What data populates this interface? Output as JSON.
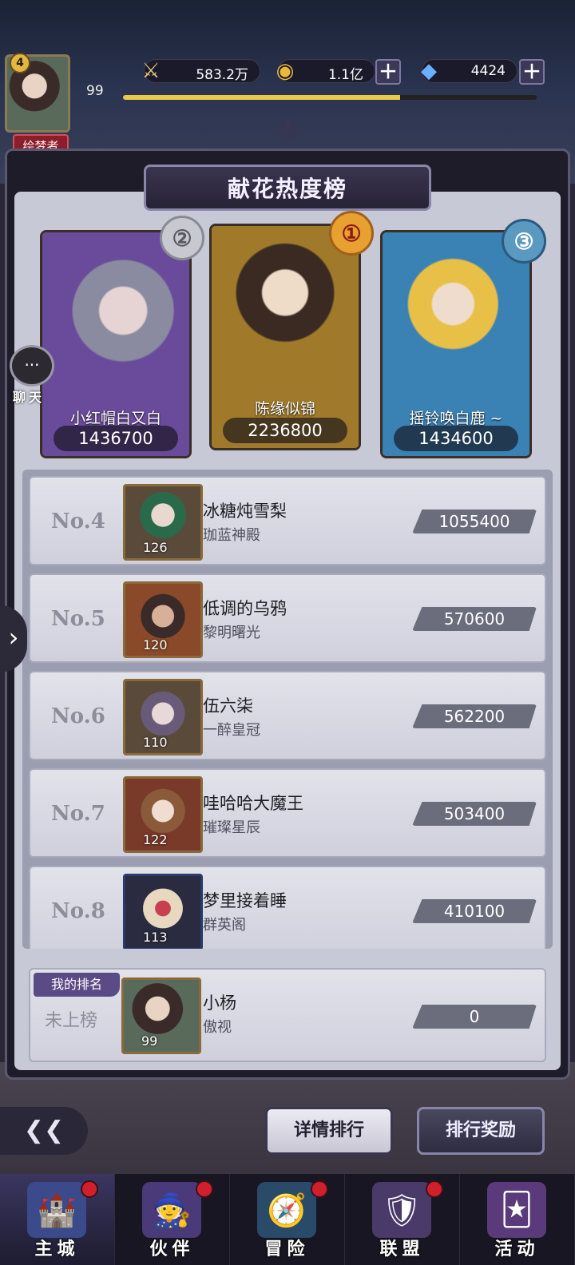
{
  "hud": {
    "avatar_level": "4",
    "player_level": "99",
    "title": "绘梦者",
    "title_gems": "◆◆◆",
    "power": "583.2万",
    "gold": "1.1亿",
    "diamonds": "4424",
    "exp_progress": 0.67
  },
  "board": {
    "title": "献花热度榜"
  },
  "podium": [
    {
      "rank": "②",
      "name": "小红帽白又白",
      "score": "1436700",
      "bg": "#6a4a9a"
    },
    {
      "rank": "①",
      "name": "陈缘似锦",
      "score": "2236800",
      "bg": "#a07a2a"
    },
    {
      "rank": "③",
      "name": "摇铃唤白鹿 ~",
      "score": "1434600",
      "bg": "#3a82b4"
    }
  ],
  "ranks": [
    {
      "no": "No.4",
      "name": "冰糖炖雪梨",
      "guild": "珈蓝神殿",
      "level": "126",
      "score": "1055400"
    },
    {
      "no": "No.5",
      "name": "低调的乌鸦",
      "guild": "黎明曙光",
      "level": "120",
      "score": "570600"
    },
    {
      "no": "No.6",
      "name": "伍六柒",
      "guild": "一醉皇冠",
      "level": "110",
      "score": "562200"
    },
    {
      "no": "No.7",
      "name": "哇哈哈大魔王",
      "guild": "璀璨星辰",
      "level": "122",
      "score": "503400"
    },
    {
      "no": "No.8",
      "name": "梦里接着睡",
      "guild": "群英阁",
      "level": "113",
      "score": "410100"
    }
  ],
  "my_rank": {
    "tag": "我的排名",
    "status": "未上榜",
    "name": "小杨",
    "guild": "傲视",
    "level": "99",
    "score": "0"
  },
  "side": {
    "chat_label": "聊天",
    "chat_icon": "···",
    "arrow": "›"
  },
  "actions": {
    "back": "❮❮",
    "detail": "详情排行",
    "reward": "排行奖励"
  },
  "nav": [
    {
      "label": "主城",
      "icon": "🏰",
      "active": true
    },
    {
      "label": "伙伴",
      "icon": "🧙",
      "active": false
    },
    {
      "label": "冒险",
      "icon": "🧭",
      "active": false
    },
    {
      "label": "联盟",
      "icon": "🛡",
      "active": false
    },
    {
      "label": "活动",
      "icon": "🃏",
      "active": false
    }
  ],
  "icons": {
    "power": "sword-wings-icon",
    "gold": "gold-coin-icon",
    "diamond": "diamond-icon",
    "plus": "＋"
  }
}
